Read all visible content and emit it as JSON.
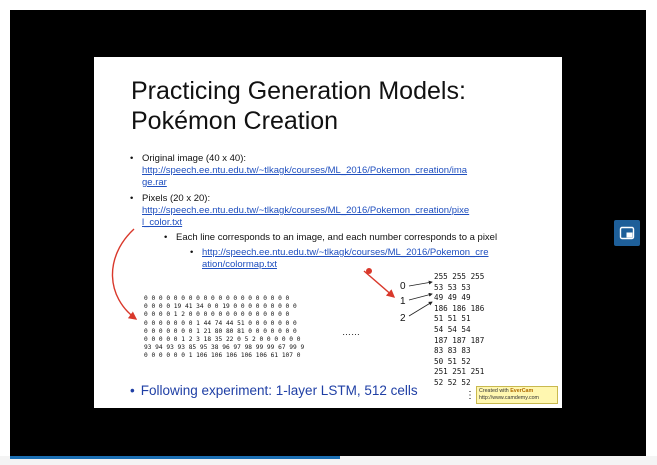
{
  "slide": {
    "title_line1": "Practicing Generation Models:",
    "title_line2": "Pokémon Creation",
    "bullet_symbol": "•",
    "item1_label": "Original image (40 x 40):",
    "item1_link_a": "http://speech.ee.ntu.edu.tw/~tlkagk/courses/ML_2016/Pokemon_creation/ima",
    "item1_link_b": "ge.rar",
    "item2_label": "Pixels (20 x 20):",
    "item2_link_a": "http://speech.ee.ntu.edu.tw/~tlkagk/courses/ML_2016/Pokemon_creation/pixe",
    "item2_link_b": "l_color.txt",
    "sub_bullet": "Each line corresponds to an image, and each number corresponds to a pixel",
    "sub_link_a": "http://speech.ee.ntu.edu.tw/~tlkagk/courses/ML_2016/Pokemon_cre",
    "sub_link_b": "ation/colormap.txt",
    "pixel_matrix": "0 0 0 0 0 0 0 0 0 0 0 0 0 0 0 0 0 0 0 0\n0 0 0 0 19 41 34 0 0 19 0 0 0 0 0 0 0 0 0\n0 0 0 0 1 2 0 0 0 0 0 0 0 0 0 0 0 0 0 0\n0 0 0 0 0 0 0 1 44 74 44 51 0 0 0 0 0 0 0\n0 0 0 0 0 0 0 1 21 80 80 81 0 0 0 0 0 0 0\n0 0 0 0 0 1 2 3 18 35 22 0 5 2 0 0 0 0 0 0\n93 94 93 93 85 95 38 96 97 98 99 99 67 99 9\n0 0 0 0 0 0 1 106 106 106 106 106 61 107 0",
    "ellipsis": "……",
    "colormap_rows": "255 255 255\n53 53 53\n49 49 49\n186 186 186\n51 51 51\n54 54 54\n187 187 187\n83 83 83\n50 51 52\n251 251 251\n52 52 52",
    "index_labels": [
      "0",
      "1",
      "2"
    ],
    "footer": "Following experiment: 1-layer LSTM, 512 cells",
    "menu_dots": "⋮",
    "watermark_line1_prefix": "Created with ",
    "watermark_brand": "EverCam",
    "watermark_line2": "http://www.camdemy.com"
  },
  "colors": {
    "link": "#1f4fbf",
    "footer": "#1f3fa5",
    "arrow": "#d9382b",
    "side_button": "#1e5f99"
  },
  "icons": {
    "side_button": "picture-in-picture-icon"
  }
}
